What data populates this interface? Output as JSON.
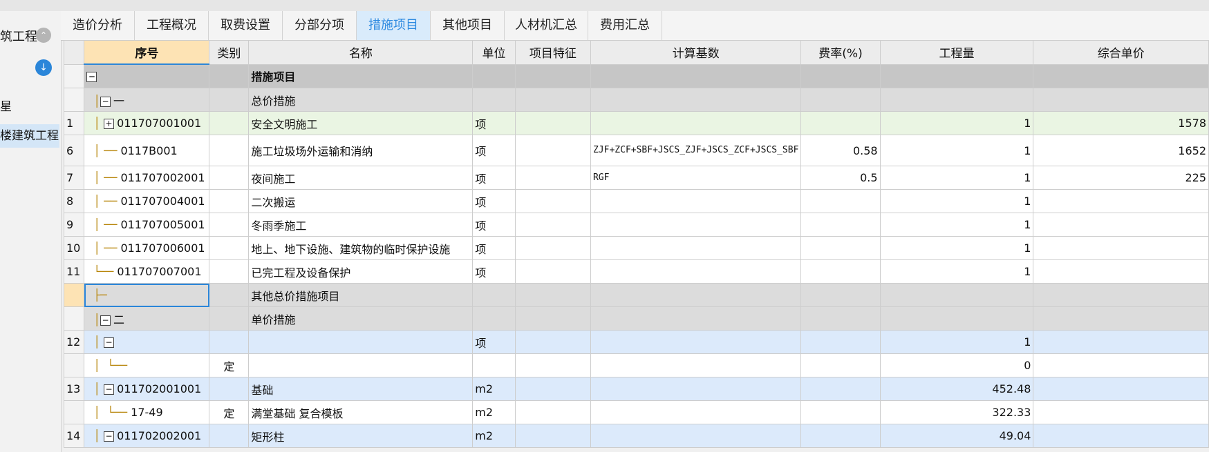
{
  "left_panel": {
    "project_title": "筑工程",
    "tree_partial": "星",
    "tree_selected": "楼建筑工程"
  },
  "tabs": [
    {
      "label": "造价分析"
    },
    {
      "label": "工程概况"
    },
    {
      "label": "取费设置"
    },
    {
      "label": "分部分项"
    },
    {
      "label": "措施项目"
    },
    {
      "label": "其他项目"
    },
    {
      "label": "人材机汇总"
    },
    {
      "label": "费用汇总"
    }
  ],
  "active_tab": "措施项目",
  "columns": [
    "序号",
    "类别",
    "名称",
    "单位",
    "项目特征",
    "计算基数",
    "费率(%)",
    "工程量",
    "综合单价"
  ],
  "rows": [
    {
      "row": "",
      "expander": "−",
      "code": "",
      "type": "",
      "name": "措施项目",
      "unit": "",
      "feature": "",
      "calc": "",
      "rate": "",
      "qty": "",
      "price": ""
    },
    {
      "row": "",
      "expander": "−",
      "code": "一",
      "type": "",
      "name": "总价措施",
      "unit": "",
      "feature": "",
      "calc": "",
      "rate": "",
      "qty": "",
      "price": ""
    },
    {
      "row": "1",
      "expander": "+",
      "code": "011707001001",
      "type": "",
      "name": "安全文明施工",
      "unit": "项",
      "feature": "",
      "calc": "",
      "rate": "",
      "qty": "1",
      "price": "1578"
    },
    {
      "row": "6",
      "expander": "",
      "code": "0117B001",
      "type": "",
      "name": "施工垃圾场外运输和消纳",
      "unit": "项",
      "feature": "",
      "calc": "ZJF+ZCF+SBF+JSCS_ZJF+JSCS_ZCF+JSCS_SBF",
      "rate": "0.58",
      "qty": "1",
      "price": "1652"
    },
    {
      "row": "7",
      "expander": "",
      "code": "011707002001",
      "type": "",
      "name": "夜间施工",
      "unit": "项",
      "feature": "",
      "calc": "RGF",
      "rate": "0.5",
      "qty": "1",
      "price": "225"
    },
    {
      "row": "8",
      "expander": "",
      "code": "011707004001",
      "type": "",
      "name": "二次搬运",
      "unit": "项",
      "feature": "",
      "calc": "",
      "rate": "",
      "qty": "1",
      "price": ""
    },
    {
      "row": "9",
      "expander": "",
      "code": "011707005001",
      "type": "",
      "name": "冬雨季施工",
      "unit": "项",
      "feature": "",
      "calc": "",
      "rate": "",
      "qty": "1",
      "price": ""
    },
    {
      "row": "10",
      "expander": "",
      "code": "011707006001",
      "type": "",
      "name": "地上、地下设施、建筑物的临时保护设施",
      "unit": "项",
      "feature": "",
      "calc": "",
      "rate": "",
      "qty": "1",
      "price": ""
    },
    {
      "row": "11",
      "expander": "",
      "code": "011707007001",
      "type": "",
      "name": "已完工程及设备保护",
      "unit": "项",
      "feature": "",
      "calc": "",
      "rate": "",
      "qty": "1",
      "price": ""
    },
    {
      "row": "",
      "expander": "",
      "code": "",
      "type": "",
      "name": "其他总价措施项目",
      "unit": "",
      "feature": "",
      "calc": "",
      "rate": "",
      "qty": "",
      "price": ""
    },
    {
      "row": "",
      "expander": "−",
      "code": "二",
      "type": "",
      "name": "单价措施",
      "unit": "",
      "feature": "",
      "calc": "",
      "rate": "",
      "qty": "",
      "price": ""
    },
    {
      "row": "12",
      "expander": "−",
      "code": "",
      "type": "",
      "name": "",
      "unit": "项",
      "feature": "",
      "calc": "",
      "rate": "",
      "qty": "1",
      "price": ""
    },
    {
      "row": "",
      "expander": "",
      "code": "",
      "type": "定",
      "name": "",
      "unit": "",
      "feature": "",
      "calc": "",
      "rate": "",
      "qty": "0",
      "price": ""
    },
    {
      "row": "13",
      "expander": "−",
      "code": "011702001001",
      "type": "",
      "name": "基础",
      "unit": "m2",
      "feature": "",
      "calc": "",
      "rate": "",
      "qty": "452.48",
      "price": ""
    },
    {
      "row": "",
      "expander": "",
      "code": "17-49",
      "type": "定",
      "name": "满堂基础 复合模板",
      "unit": "m2",
      "feature": "",
      "calc": "",
      "rate": "",
      "qty": "322.33",
      "price": ""
    },
    {
      "row": "14",
      "expander": "−",
      "code": "011702002001",
      "type": "",
      "name": "矩形柱",
      "unit": "m2",
      "feature": "",
      "calc": "",
      "rate": "",
      "qty": "49.04",
      "price": ""
    }
  ]
}
